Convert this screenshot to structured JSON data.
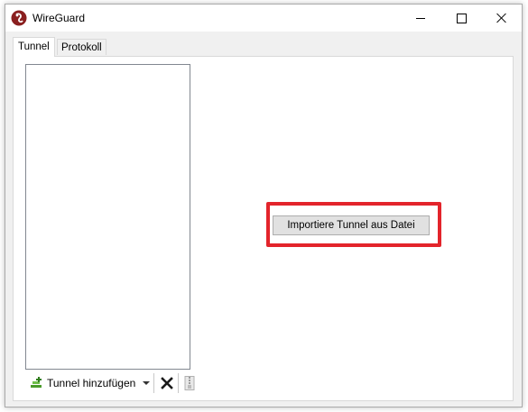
{
  "window": {
    "title": "WireGuard",
    "controls": [
      "minimize-icon",
      "maximize-icon",
      "close-icon"
    ]
  },
  "tabs": [
    {
      "label": "Tunnel",
      "active": true
    },
    {
      "label": "Protokoll",
      "active": false
    }
  ],
  "tunnel_list": {
    "items": []
  },
  "toolbar": {
    "add_label": "Tunnel hinzufügen",
    "add_icon": "add-tunnel-icon",
    "delete_icon": "delete-x-icon",
    "export_icon": "export-zip-icon"
  },
  "main": {
    "import_button_label": "Importiere Tunnel aus Datei"
  },
  "colors": {
    "highlight": "#e3242b",
    "brand": "#8a1f1f",
    "add_icon_green": "#4a9a2a"
  }
}
